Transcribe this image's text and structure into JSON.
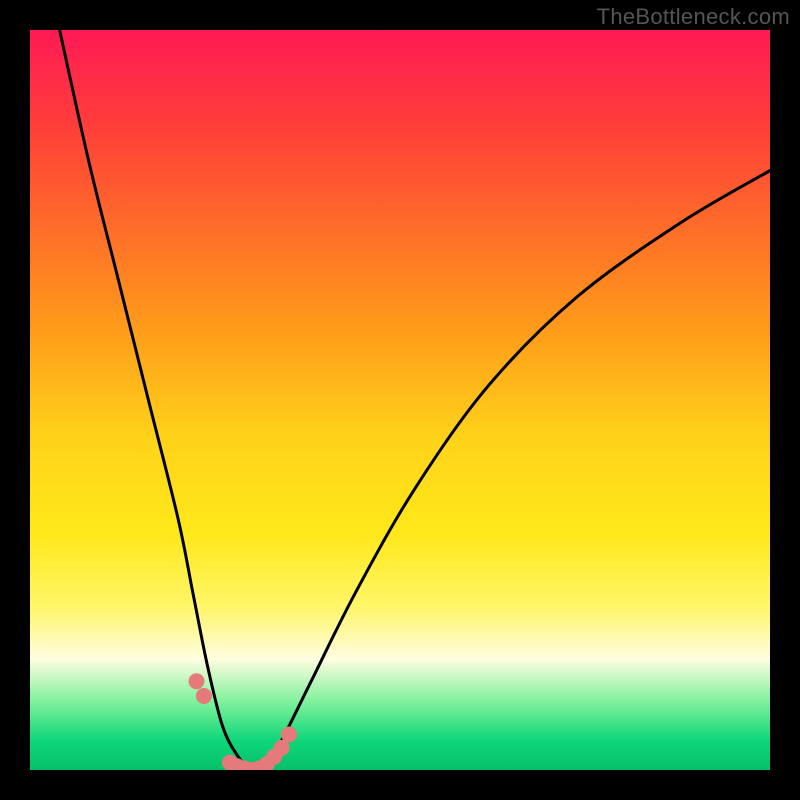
{
  "watermark": "TheBottleneck.com",
  "chart_data": {
    "type": "line",
    "title": "",
    "xlabel": "",
    "ylabel": "",
    "xlim": [
      0,
      100
    ],
    "ylim": [
      0,
      100
    ],
    "background_gradient": {
      "top": "#ff1a55",
      "mid": "#ffe81a",
      "bottom": "#06c06a"
    },
    "series": [
      {
        "name": "bottleneck-curve",
        "stroke": "#000000",
        "x": [
          4,
          8,
          12,
          16,
          20,
          22,
          24,
          26,
          28,
          30,
          32,
          34,
          38,
          44,
          52,
          62,
          74,
          88,
          100
        ],
        "values": [
          100,
          82,
          66,
          50,
          34,
          24,
          14,
          6,
          2,
          0,
          1,
          4,
          12,
          24,
          38,
          52,
          64,
          74,
          81
        ]
      }
    ],
    "marker_points": {
      "name": "highlight-markers",
      "color": "#e47a7a",
      "radius_px": 8,
      "x": [
        22.5,
        23.5,
        27.0,
        28.0,
        29.0,
        30.0,
        31.0,
        32.0,
        33.0,
        34.0,
        35.0
      ],
      "values": [
        12.0,
        10.0,
        1.0,
        0.5,
        0.2,
        0.0,
        0.2,
        0.8,
        1.8,
        3.0,
        4.8
      ]
    }
  }
}
